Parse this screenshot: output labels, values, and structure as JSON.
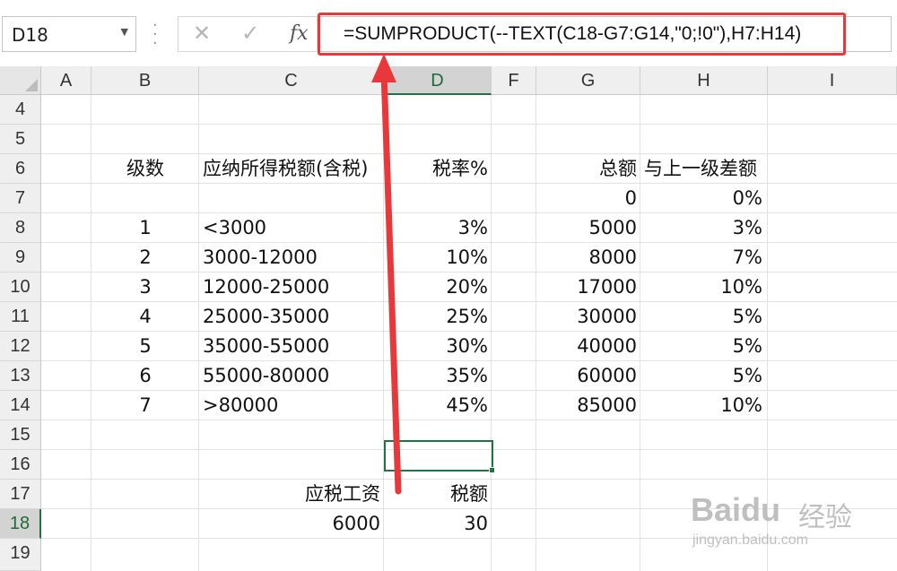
{
  "formula_bar": {
    "name_box": "D18",
    "formula": "=SUMPRODUCT(--TEXT(C18-G7:G14,\"0;!0\"),H7:H14)",
    "fx_label": "fx"
  },
  "columns": [
    "A",
    "B",
    "C",
    "D",
    "F",
    "G",
    "H",
    "I"
  ],
  "selected_column": "D",
  "rows": [
    "4",
    "5",
    "6",
    "7",
    "8",
    "9",
    "10",
    "11",
    "12",
    "13",
    "14",
    "15",
    "16",
    "17",
    "18",
    "19"
  ],
  "selected_row": "18",
  "table": {
    "header": {
      "level": "级数",
      "taxable_income": "应纳所得税额(含税)",
      "rate": "税率%",
      "total": "总额",
      "diff": "与上一级差额"
    },
    "row7": {
      "total": "0",
      "diff": "0%"
    },
    "brackets": [
      {
        "level": "1",
        "range": "<3000",
        "rate": "3%",
        "total": "5000",
        "diff": "3%"
      },
      {
        "level": "2",
        "range": "3000-12000",
        "rate": "10%",
        "total": "8000",
        "diff": "7%"
      },
      {
        "level": "3",
        "range": "12000-25000",
        "rate": "20%",
        "total": "17000",
        "diff": "10%"
      },
      {
        "level": "4",
        "range": "25000-35000",
        "rate": "25%",
        "total": "30000",
        "diff": "5%"
      },
      {
        "level": "5",
        "range": "35000-55000",
        "rate": "30%",
        "total": "40000",
        "diff": "5%"
      },
      {
        "level": "6",
        "range": "55000-80000",
        "rate": "35%",
        "total": "60000",
        "diff": "5%"
      },
      {
        "level": "7",
        "range": ">80000",
        "rate": "45%",
        "total": "85000",
        "diff": "10%"
      }
    ]
  },
  "calc": {
    "salary_label": "应税工资",
    "tax_label": "税额",
    "salary_value": "6000",
    "tax_value": "30"
  },
  "watermark": {
    "logo": "Bai",
    "logo2": "du",
    "cn": "经验",
    "url": "jingyan.baidu.com"
  },
  "colors": {
    "excel_green": "#217346",
    "annotation_red": "#e8383a"
  }
}
